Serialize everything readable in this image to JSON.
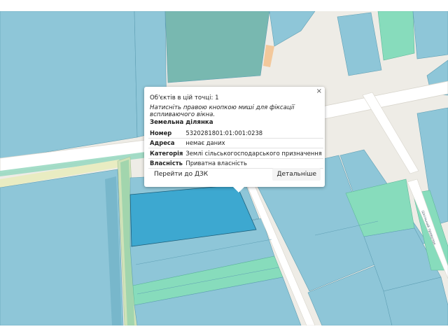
{
  "map": {
    "colors": {
      "background": "#eeece6",
      "parcel_blue": "#8ec6d8",
      "parcel_teal": "#6fd0b7",
      "parcel_green": "#87dcbc",
      "selected_parcel": "#3da8d0",
      "road": "#ffffff",
      "road_edge": "#d8d5cc"
    },
    "street_label": "Шкільний провулок"
  },
  "popup": {
    "objects_text": "Об'єктів в цій точці: 1",
    "hint_text": "Натисніть правою кнопкою миші для фіксації вспливаючого вікна.",
    "close_label": "×",
    "section_title": "Земельна ділянка",
    "rows": [
      {
        "key": "Номер",
        "value": "5320281801:01:001:0238"
      },
      {
        "key": "Адреса",
        "value": "немає даних"
      },
      {
        "key": "Категорія",
        "value": "Землі сільськогосподарського призначення"
      },
      {
        "key": "Власність",
        "value": "Приватна власність"
      }
    ],
    "btn_dzk": "Перейти до ДЗК",
    "btn_more": "Детальніше"
  }
}
